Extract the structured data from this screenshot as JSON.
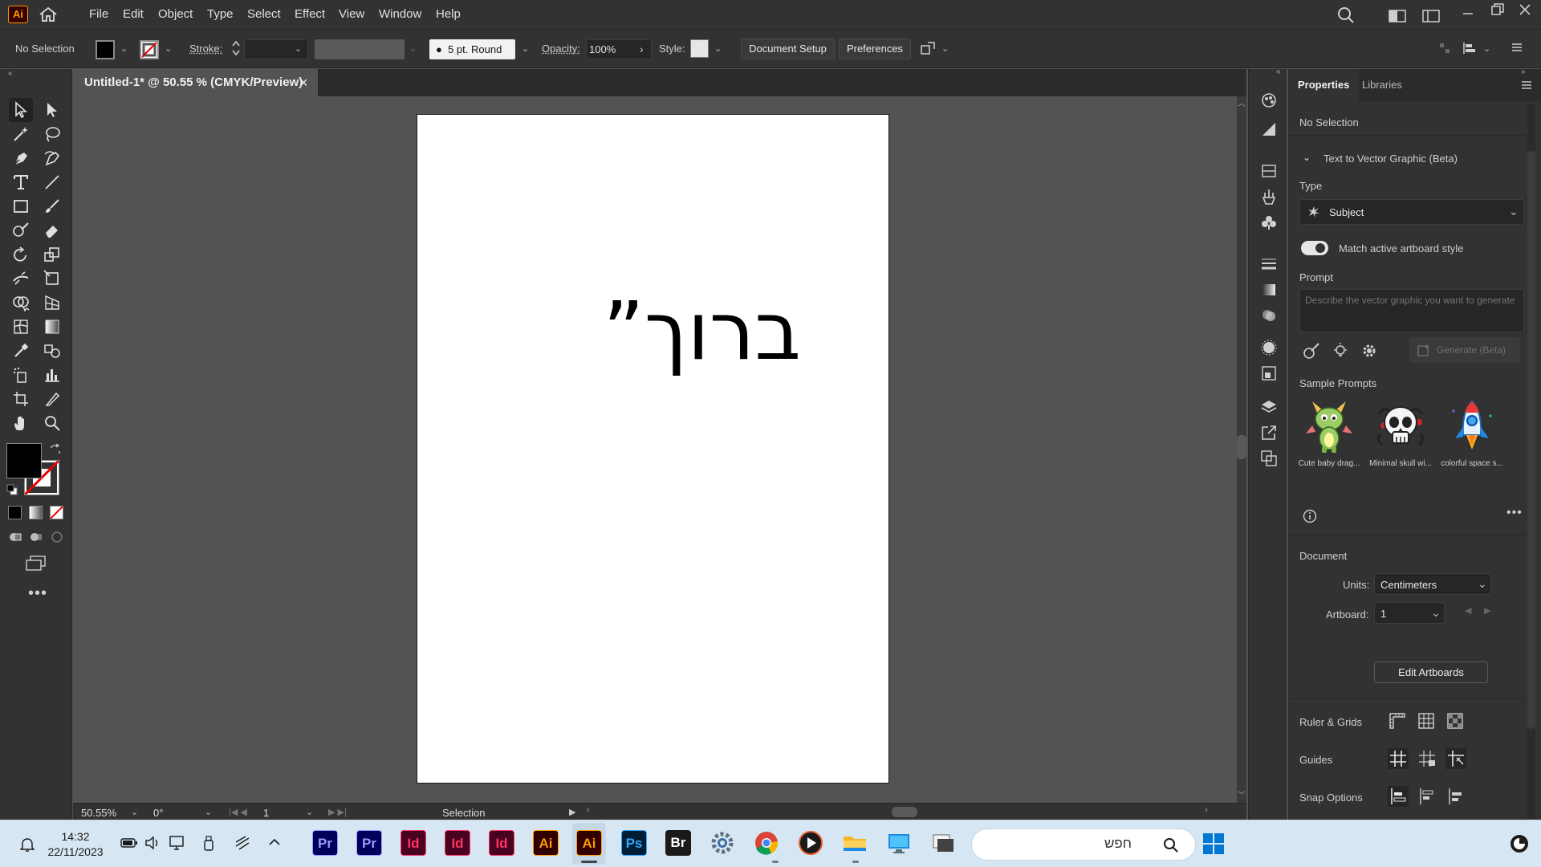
{
  "app": {
    "logo_text": "Ai"
  },
  "menu": [
    "File",
    "Edit",
    "Object",
    "Type",
    "Select",
    "Effect",
    "View",
    "Window",
    "Help"
  ],
  "control_bar": {
    "selection_status": "No Selection",
    "stroke_label": "Stroke:",
    "brush_label": "5 pt. Round",
    "opacity_label": "Opacity:",
    "opacity_value": "100%",
    "style_label": "Style:",
    "document_setup": "Document Setup",
    "preferences": "Preferences"
  },
  "document": {
    "tab_title": "Untitled-1* @ 50.55 % (CMYK/Preview)",
    "close_glyph": "×",
    "artboard_text": "ברוך”"
  },
  "status_bar": {
    "zoom": "50.55%",
    "rotation": "0°",
    "artboard_number": "1",
    "tool_name": "Selection"
  },
  "properties_panel": {
    "tabs": [
      "Properties",
      "Libraries"
    ],
    "selection_status": "No Selection",
    "section_title": "Text to Vector Graphic (Beta)",
    "type_label": "Type",
    "type_value": "Subject",
    "match_style_label": "Match active artboard style",
    "match_style_on": true,
    "prompt_label": "Prompt",
    "prompt_placeholder": "Describe the vector graphic you want to generate",
    "generate_button": "Generate (Beta)",
    "sample_prompts_label": "Sample Prompts",
    "samples": [
      {
        "label": "Cute baby drag...",
        "icon": "dragon-icon"
      },
      {
        "label": "Minimal skull wi...",
        "icon": "skull-icon"
      },
      {
        "label": "colorful space s...",
        "icon": "rocket-icon"
      }
    ],
    "document_label": "Document",
    "units_label": "Units:",
    "units_value": "Centimeters",
    "artboard_label": "Artboard:",
    "artboard_value": "1",
    "edit_artboards_button": "Edit Artboards",
    "ruler_grids_label": "Ruler & Grids",
    "guides_label": "Guides",
    "snap_options_label": "Snap Options"
  },
  "taskbar": {
    "time": "14:32",
    "date": "22/11/2023",
    "search_placeholder": "חפש",
    "apps": [
      {
        "label": "Pr",
        "bg": "#00005b",
        "fg": "#9999ff"
      },
      {
        "label": "Pr",
        "bg": "#00005b",
        "fg": "#9999ff"
      },
      {
        "label": "Id",
        "bg": "#49021f",
        "fg": "#ff3366"
      },
      {
        "label": "Id",
        "bg": "#49021f",
        "fg": "#ff3366"
      },
      {
        "label": "Id",
        "bg": "#49021f",
        "fg": "#ff3366"
      },
      {
        "label": "Ai",
        "bg": "#330000",
        "fg": "#ff9a00"
      },
      {
        "label": "Ai",
        "bg": "#330000",
        "fg": "#ff9a00"
      },
      {
        "label": "Ps",
        "bg": "#001e36",
        "fg": "#31a8ff"
      },
      {
        "label": "Br",
        "bg": "#1a1a1a",
        "fg": "#ffffff"
      }
    ]
  },
  "colors": {
    "accent_ai": "#ff9a00",
    "panel_bg": "#323232",
    "canvas_bg": "#535353",
    "taskbar_bg": "#d6e6f2"
  }
}
